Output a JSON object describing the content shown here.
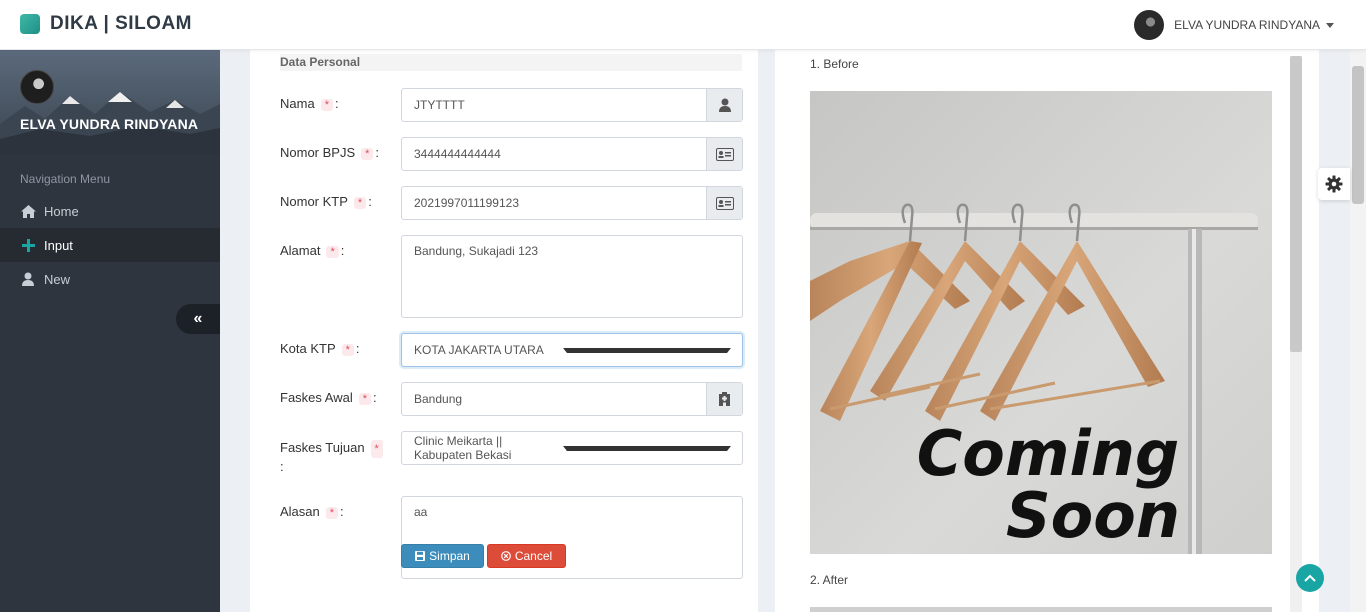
{
  "brand": {
    "title": "DIKA | SILOAM"
  },
  "header": {
    "user_name": "ELVA YUNDRA RINDYANA"
  },
  "sidebar": {
    "user_name": "ELVA YUNDRA RINDYANA",
    "nav_header": "Navigation Menu",
    "items": [
      {
        "label": "Home",
        "icon": "home-icon",
        "active": false
      },
      {
        "label": "Input",
        "icon": "plus-icon",
        "active": true
      },
      {
        "label": "New",
        "icon": "user-icon",
        "active": false
      }
    ]
  },
  "form": {
    "section_title": "Data Personal",
    "required_mark": "*",
    "nama": {
      "label": "Nama",
      "colon": ":",
      "value": "JTYTTTT",
      "icon": "user-icon"
    },
    "bpjs": {
      "label": "Nomor BPJS",
      "colon": ":",
      "value": "3444444444444",
      "icon": "id-card-icon"
    },
    "ktp": {
      "label": "Nomor KTP",
      "colon": ":",
      "value": "2021997011199123",
      "icon": "id-card-icon"
    },
    "alamat": {
      "label": "Alamat",
      "colon": ":",
      "value": "Bandung, Sukajadi 123"
    },
    "kota_ktp": {
      "label": "Kota KTP",
      "colon": ":",
      "value": "KOTA JAKARTA UTARA"
    },
    "faskes_awal": {
      "label": "Faskes Awal",
      "colon": ":",
      "value": "Bandung",
      "icon": "hospital-icon"
    },
    "faskes_tujuan": {
      "label": "Faskes Tujuan",
      "colon": ":",
      "value": "Clinic Meikarta || Kabupaten Bekasi"
    },
    "alasan": {
      "label": "Alasan",
      "colon": ":",
      "value": "aa"
    },
    "save_label": "Simpan",
    "cancel_label": "Cancel"
  },
  "preview": {
    "before_label": "1. Before",
    "after_label": "2. After",
    "image_text_line1": "Coming",
    "image_text_line2": "Soon"
  },
  "colors": {
    "sidebar_bg": "#2f353e",
    "accent": "#1aa5a5",
    "save_button": "#3c8dbc",
    "cancel_button": "#dd4b39",
    "required_mark": "#e24b5f"
  }
}
